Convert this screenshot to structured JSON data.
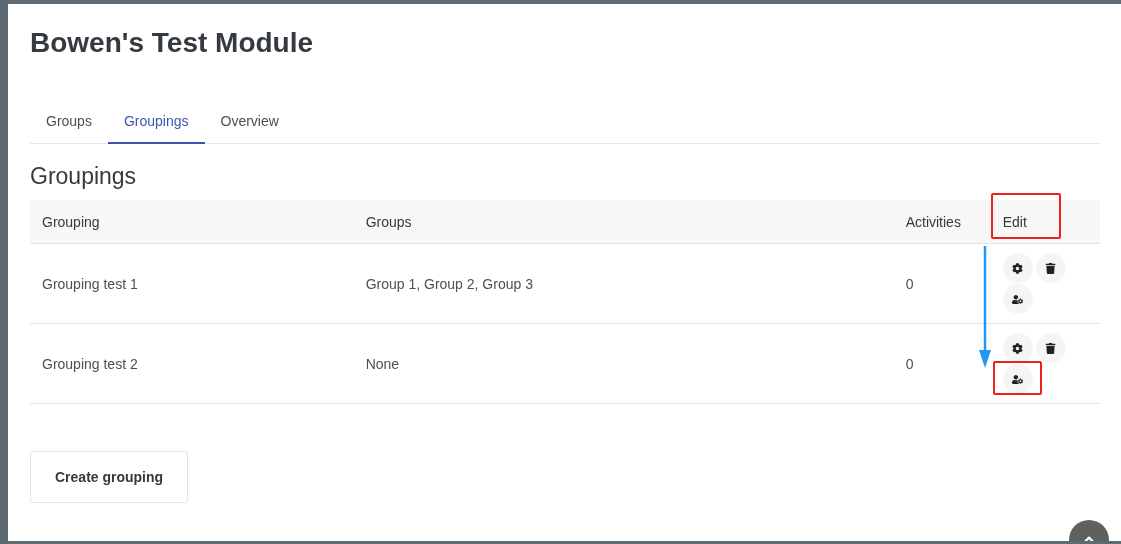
{
  "page_title": "Bowen's Test Module",
  "tabs": [
    {
      "label": "Groups",
      "selected": false
    },
    {
      "label": "Groupings",
      "selected": true
    },
    {
      "label": "Overview",
      "selected": false
    }
  ],
  "section_title": "Groupings",
  "table": {
    "columns": [
      {
        "label": "Grouping",
        "annotated": false
      },
      {
        "label": "Groups",
        "annotated": false
      },
      {
        "label": "Activities",
        "annotated": false
      },
      {
        "label": "Edit",
        "annotated": true
      }
    ],
    "rows": [
      {
        "grouping": "Grouping test 1",
        "groups": "Group 1, Group 2, Group 3",
        "activities": "0",
        "actions": [
          {
            "kind": "settings",
            "annotated": false
          },
          {
            "kind": "delete",
            "annotated": false
          },
          {
            "kind": "members",
            "annotated": false
          }
        ]
      },
      {
        "grouping": "Grouping test 2",
        "groups": "None",
        "activities": "0",
        "actions": [
          {
            "kind": "settings",
            "annotated": false
          },
          {
            "kind": "delete",
            "annotated": false
          },
          {
            "kind": "members",
            "annotated": true
          }
        ]
      }
    ]
  },
  "create_button": "Create grouping"
}
